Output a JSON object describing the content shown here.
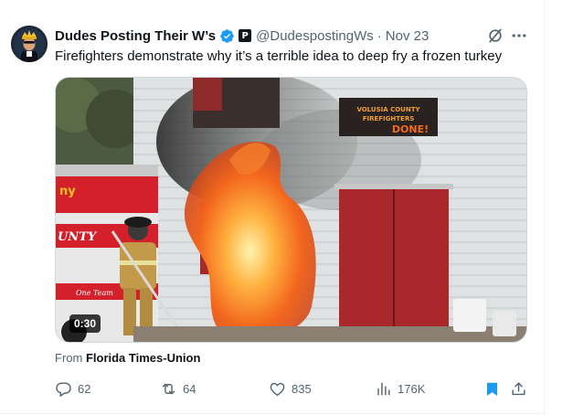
{
  "tweet": {
    "display_name": "Dudes Posting Their W’s",
    "handle": "@DudespostingWs",
    "separator": "·",
    "date": "Nov 23",
    "text": "Firefighters demonstrate why it’s a terrible idea to deep fry a frozen turkey",
    "video_duration": "0:30",
    "source_prefix": "From ",
    "source_name": "Florida Times-Union",
    "affiliate_badge": "P",
    "media_sign_line1": "VOLUSIA COUNTY",
    "media_sign_line2": "FIREFIGHTERS",
    "media_sign_line3": "DONE!",
    "media_truck_text1": "ny",
    "media_truck_text2": "UNTY",
    "media_truck_text3": "One Team"
  },
  "actions": {
    "replies": "62",
    "reposts": "64",
    "likes": "835",
    "views": "176K"
  },
  "icons": {
    "verified": "verified-badge-icon",
    "affiliate": "affiliate-badge-icon",
    "grok": "grok-icon",
    "more": "more-icon",
    "reply": "reply-icon",
    "repost": "repost-icon",
    "like": "heart-icon",
    "views": "views-icon",
    "bookmark": "bookmark-icon",
    "share": "share-icon"
  },
  "colors": {
    "verified_blue": "#1d9bf0",
    "text_primary": "#0f1419",
    "text_secondary": "#536471",
    "bookmark_active": "#1d9bf0"
  }
}
